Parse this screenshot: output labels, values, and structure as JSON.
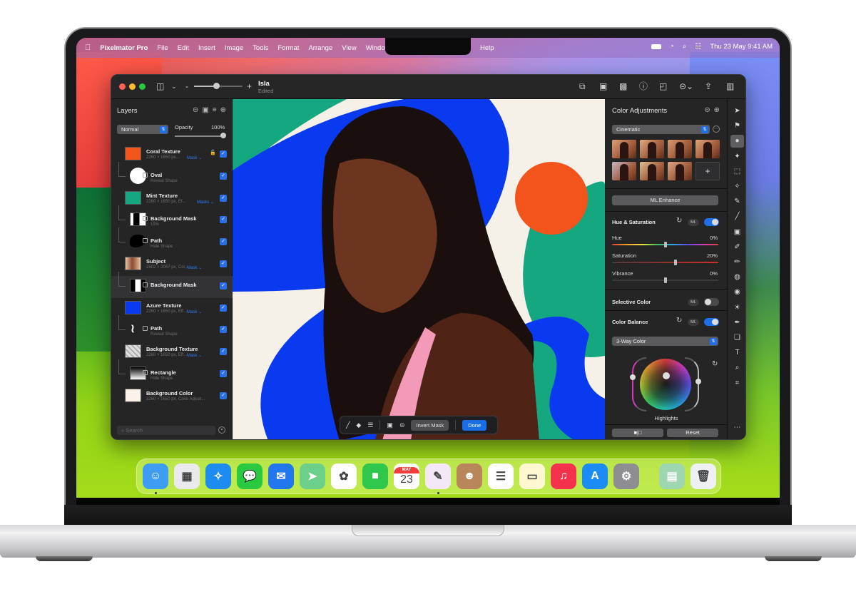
{
  "menubar": {
    "apple_icon": "apple-logo-icon",
    "app_name": "Pixelmator Pro",
    "menus": [
      "File",
      "Edit",
      "Insert",
      "Image",
      "Tools",
      "Format",
      "Arrange",
      "View",
      "Window"
    ],
    "help": "Help",
    "status_icons": [
      "battery-icon",
      "wifi-icon",
      "spotlight-search-icon",
      "control-center-icon"
    ],
    "clock": "Thu 23 May  9:41 AM"
  },
  "window": {
    "title": "Isla",
    "subtitle": "Edited",
    "zoom_level_fraction": 0.45,
    "toolbar_icons": [
      "arrange-icon",
      "color-swap-icon",
      "image-adjust-icon",
      "info-icon",
      "crop-rotate-icon",
      "more-menu-icon",
      "share-icon",
      "sidebar-icon"
    ]
  },
  "layers_panel": {
    "title": "Layers",
    "blend_mode": "Normal",
    "opacity_label": "Opacity",
    "opacity_value": "100%",
    "search_placeholder": "Search",
    "layers": [
      {
        "name": "Coral Texture",
        "meta": "2260 × 1650 px...",
        "mask": "Mask ⌄",
        "child": false,
        "thumb": "#f2541b",
        "locked": true,
        "checked": true
      },
      {
        "name": "Oval",
        "meta": "Reveal Shape",
        "child": true,
        "thumb": "oval",
        "shape": true,
        "checked": true
      },
      {
        "name": "Mint Texture",
        "meta": "2260 × 1650 px, Ef...",
        "mask": "Masks ⌄",
        "child": false,
        "thumb": "#15a880",
        "checked": true
      },
      {
        "name": "Background Mask",
        "meta": "15%",
        "child": true,
        "thumb": "mask",
        "mask_icon": true,
        "checked": true
      },
      {
        "name": "Path",
        "meta": "Hide Shape",
        "child": true,
        "thumb": "blob",
        "shape": true,
        "checked": true
      },
      {
        "name": "Subject",
        "meta": "2502 × 2067 px, Col...",
        "mask": "Mask ⌄",
        "child": false,
        "thumb": "portrait",
        "checked": true
      },
      {
        "name": "Background Mask",
        "meta": "",
        "child": true,
        "thumb": "mask2",
        "mask_icon": true,
        "selected": true,
        "checked": true
      },
      {
        "name": "Azure Texture",
        "meta": "2260 × 1650 px, Eff...",
        "mask": "Mask ⌄",
        "child": false,
        "thumb": "#0a3af0",
        "checked": true
      },
      {
        "name": "Path",
        "meta": "Reveal Shape",
        "child": true,
        "thumb": "squiggle",
        "shape": true,
        "checked": true
      },
      {
        "name": "Background Texture",
        "meta": "2260 × 1650 px, Eff...",
        "mask": "Mask ⌄",
        "child": false,
        "thumb": "texture",
        "checked": true
      },
      {
        "name": "Rectangle",
        "meta": "Hide Shape",
        "child": true,
        "thumb": "gradient",
        "shape": true,
        "checked": true
      },
      {
        "name": "Background Color",
        "meta": "2260 × 1650 px, Color Adjust...",
        "child": false,
        "thumb": "#fbf3e9",
        "checked": true
      }
    ]
  },
  "mask_toolbar": {
    "tools": [
      "brush-icon",
      "eraser-icon",
      "sliders-icon",
      "mask-icon",
      "more-icon"
    ],
    "invert_label": "Invert Mask",
    "done_label": "Done"
  },
  "adjustments_panel": {
    "title": "Color Adjustments",
    "preset": "Cinematic",
    "preset_count": 7,
    "add_preset": "+",
    "ml_enhance": "ML Enhance",
    "hue_saturation": {
      "label": "Hue & Saturation",
      "ml": "ML",
      "enabled": true,
      "sliders": [
        {
          "label": "Hue",
          "value": "0%",
          "position": 0.5,
          "track": "rainbow"
        },
        {
          "label": "Saturation",
          "value": "20%",
          "position": 0.6,
          "track": "red"
        },
        {
          "label": "Vibrance",
          "value": "0%",
          "position": 0.5,
          "track": "grey"
        }
      ]
    },
    "selective_color": {
      "label": "Selective Color",
      "ml": "ML",
      "enabled": false
    },
    "color_balance": {
      "label": "Color Balance",
      "ml": "ML",
      "enabled": true,
      "mode": "3-Way Color",
      "wheel_label": "Highlights"
    },
    "compare_label": "■|□",
    "reset_label": "Reset"
  },
  "tools": [
    "arrow-select-icon",
    "style-icon",
    "color-adjust-icon",
    "effects-icon",
    "selection-icon",
    "quick-select-icon",
    "paint-icon",
    "brush-icon",
    "fill-icon",
    "retouch-icon",
    "eraser-icon",
    "distort-icon",
    "blur-icon",
    "light-icon",
    "pen-icon",
    "shapes-icon",
    "type-icon",
    "zoom-icon",
    "crop-icon",
    "more-icon"
  ],
  "tool_glyphs": [
    "➤",
    "⚑",
    "●",
    "✦",
    "⬚",
    "✧",
    "✎",
    "╱",
    "▣",
    "✐",
    "✏",
    "◍",
    "◉",
    "☀",
    "✒",
    "❏",
    "T",
    "⌕",
    "⌗",
    "⋯"
  ],
  "active_tool_index": 2,
  "dock": {
    "apps": [
      {
        "name": "Finder",
        "glyph": "☺",
        "color": "#3e9cf3",
        "running": true
      },
      {
        "name": "Launchpad",
        "glyph": "▦",
        "color": "#e9eaee"
      },
      {
        "name": "Safari",
        "glyph": "✧",
        "color": "#1d8cf0"
      },
      {
        "name": "Messages",
        "glyph": "💬",
        "color": "#29c940"
      },
      {
        "name": "Mail",
        "glyph": "✉",
        "color": "#2277ee"
      },
      {
        "name": "Maps",
        "glyph": "➤",
        "color": "#6dd08a"
      },
      {
        "name": "Photos",
        "glyph": "✿",
        "color": "#ffffff"
      },
      {
        "name": "FaceTime",
        "glyph": "■",
        "color": "#2fc74c"
      },
      {
        "name": "Calendar",
        "glyph": "23",
        "month": "MAY",
        "color": "#ffffff"
      },
      {
        "name": "Pixelmator Pro",
        "glyph": "✎",
        "color": "#f2e8f7",
        "running": true
      },
      {
        "name": "Contacts",
        "glyph": "☻",
        "color": "#b8865a"
      },
      {
        "name": "Reminders",
        "glyph": "☰",
        "color": "#ffffff"
      },
      {
        "name": "Notes",
        "glyph": "▭",
        "color": "#fff7cf"
      },
      {
        "name": "Music",
        "glyph": "♫",
        "color": "#f5324e"
      },
      {
        "name": "App Store",
        "glyph": "A",
        "color": "#1c8cf5"
      },
      {
        "name": "System Settings",
        "glyph": "⚙",
        "color": "#8d8d92"
      }
    ],
    "others": [
      {
        "name": "Downloads Stack",
        "glyph": "▤",
        "color": "#9ed6b0"
      },
      {
        "name": "Trash",
        "glyph": "🗑",
        "color": "#eef1f3"
      }
    ]
  }
}
